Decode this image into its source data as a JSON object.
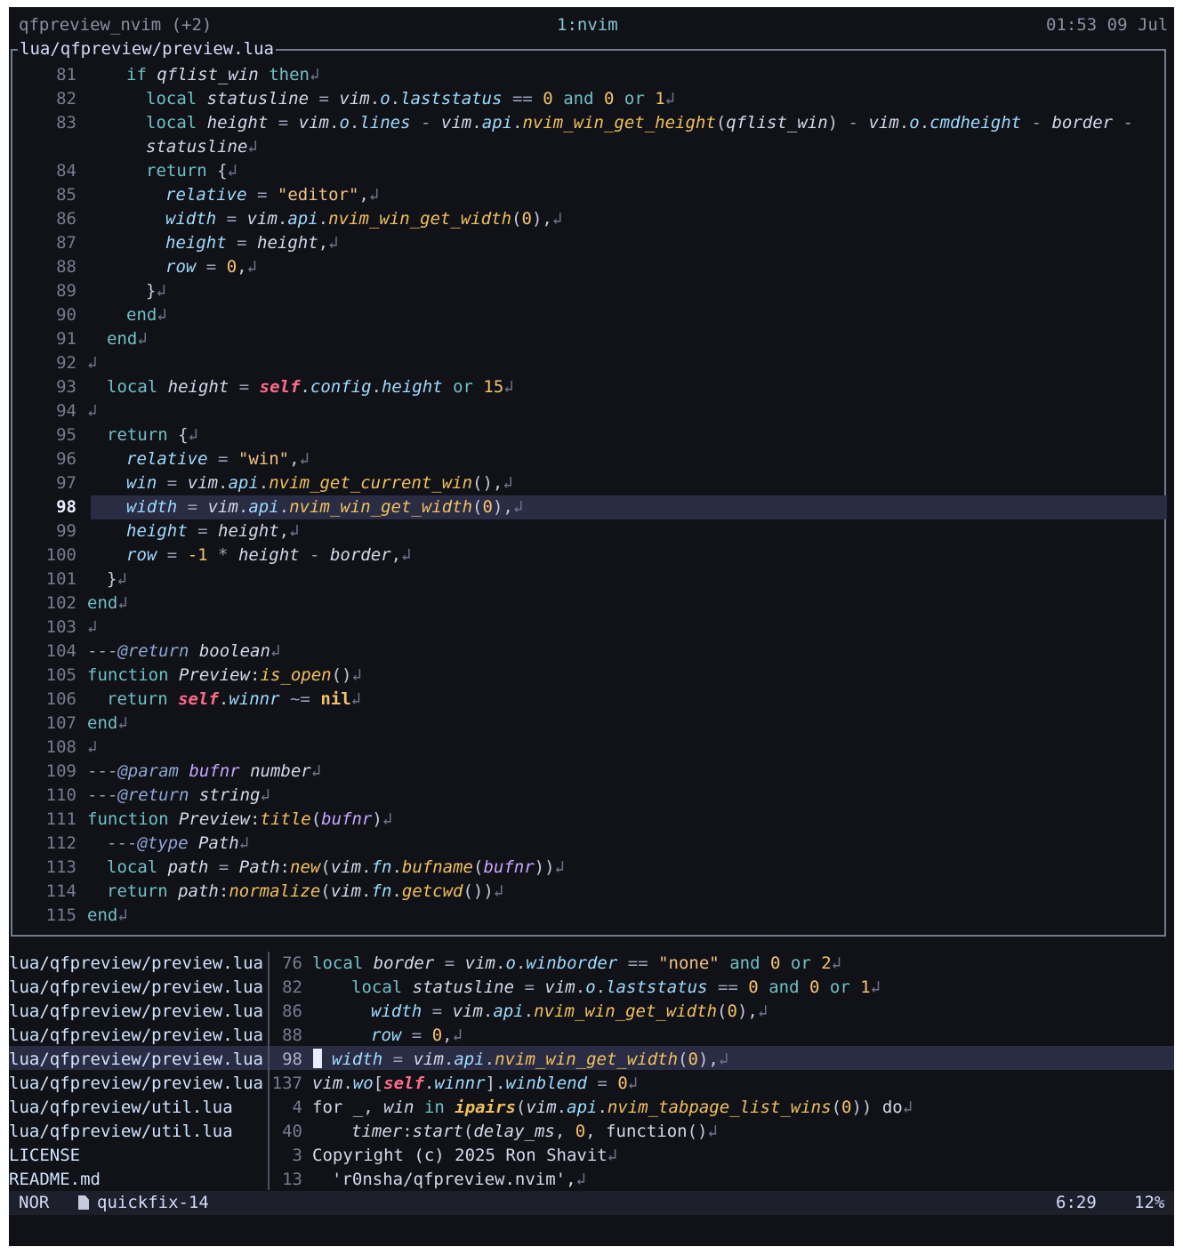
{
  "tmux": {
    "session": "qfpreview_nvim (+2)",
    "window": "1:nvim",
    "clock": "01:53 09 Jul"
  },
  "preview": {
    "title": "lua/qfpreview/preview.lua"
  },
  "line_numbers": [
    "81",
    "82",
    "83",
    "",
    "84",
    "85",
    "86",
    "87",
    "88",
    "89",
    "90",
    "91",
    "92",
    "93",
    "94",
    "95",
    "96",
    "97",
    "98",
    "99",
    "100",
    "101",
    "102",
    "103",
    "104",
    "105",
    "106",
    "107",
    "108",
    "109",
    "110",
    "111",
    "112",
    "113",
    "114",
    "115"
  ],
  "quickfix": {
    "files": [
      "lua/qfpreview/preview.lua",
      "lua/qfpreview/preview.lua",
      "lua/qfpreview/preview.lua",
      "lua/qfpreview/preview.lua",
      "lua/qfpreview/preview.lua",
      "lua/qfpreview/preview.lua",
      "lua/qfpreview/util.lua",
      "lua/qfpreview/util.lua",
      "LICENSE",
      "README.md"
    ],
    "lines": [
      "76",
      "82",
      "86",
      "88",
      "98",
      "137",
      "4",
      "40",
      "3",
      "13"
    ]
  },
  "status": {
    "mode": "NOR",
    "file_icon": "file-icon",
    "buffer": "quickfix-14",
    "position": "6:29",
    "percent": "12%"
  },
  "code_text": {
    "l81": "if qflist_win then",
    "l82": "local statusline = vim.o.laststatus == 0 and 0 or 1",
    "l83a": "local height = vim.o.lines - vim.api.nvim_win_get_height(qflist_win) - vim.o.cmdheight - border -",
    "l83b": "statusline",
    "l84": "return {",
    "l85": "relative = \"editor\",",
    "l86": "width = vim.api.nvim_win_get_width(0),",
    "l87": "height = height,",
    "l88": "row = 0,",
    "l89": "}",
    "l90": "end",
    "l91": "end",
    "l92": "",
    "l93": "local height = self.config.height or 15",
    "l94": "",
    "l95": "return {",
    "l96": "relative = \"win\",",
    "l97": "win = vim.api.nvim_get_current_win(),",
    "l98": "width = vim.api.nvim_win_get_width(0),",
    "l99": "height = height,",
    "l100": "row = -1 * height - border,",
    "l101": "}",
    "l102": "end",
    "l103": "",
    "l104": "---@return boolean",
    "l105": "function Preview:is_open()",
    "l106": "return self.winnr ~= nil",
    "l107": "end",
    "l108": "",
    "l109": "---@param bufnr number",
    "l110": "---@return string",
    "l111": "function Preview:title(bufnr)",
    "l112": "---@type Path",
    "l113": "local path = Path:new(vim.fn.bufname(bufnr))",
    "l114": "return path:normalize(vim.fn.getcwd())",
    "l115": "end",
    "q1": "local border = vim.o.winborder == \"none\" and 0 or 2",
    "q2": "local statusline = vim.o.laststatus == 0 and 0 or 1",
    "q3": "width = vim.api.nvim_win_get_width(0),",
    "q4": "row = 0,",
    "q5": "width = vim.api.nvim_win_get_width(0),",
    "q6": "vim.wo[self.winnr].winblend = 0",
    "q7": "for _, win in ipairs(vim.api.nvim_tabpage_list_wins(0)) do",
    "q8": "timer:start(delay_ms, 0, function()",
    "q9": "Copyright (c) 2025 Ron Shavit",
    "q10": "'r0nsha/qfpreview.nvim',"
  }
}
